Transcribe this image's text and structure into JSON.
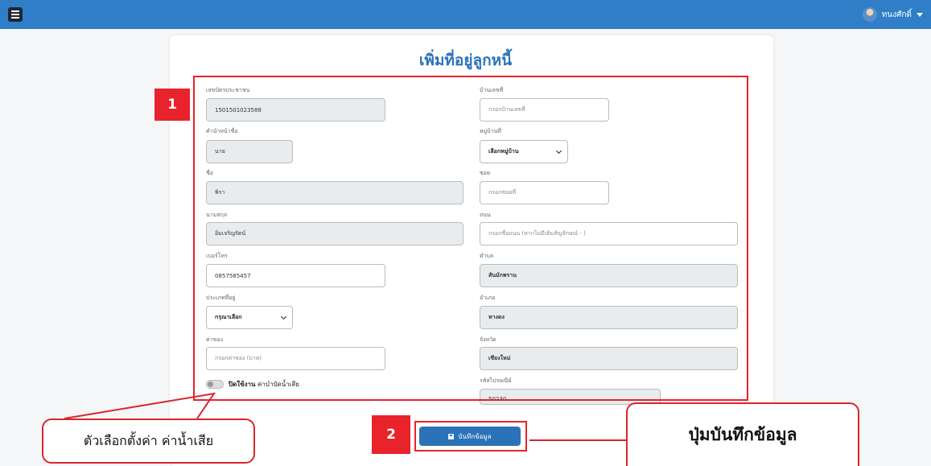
{
  "topbar": {
    "user_name": "ทนงศักดิ์"
  },
  "form": {
    "title": "เพิ่มที่อยู่ลูกหนี้",
    "left": [
      {
        "label": "เลขบัตรประชาชน",
        "value": "1501501023588"
      },
      {
        "label": "คำนำหน้าชื่อ",
        "value": "นาย"
      },
      {
        "label": "ชื่อ",
        "value": "พิรา"
      },
      {
        "label": "นามสกุล",
        "value": "อิ่มเจริญรัตน์"
      },
      {
        "label": "เบอร์โทร",
        "value": "0857585457"
      },
      {
        "label": "ประเภทที่อยู่",
        "value": "กรุณาเลือก"
      },
      {
        "label": "ค่าของ",
        "placeholder": "กรอกค่าของ (บาท)"
      }
    ],
    "right": [
      {
        "label": "บ้านเลขที่",
        "placeholder": "กรอกบ้านเลขที่"
      },
      {
        "label": "หมู่บ้านที่",
        "value": "เลือกหมู่บ้าน"
      },
      {
        "label": "ซอย",
        "placeholder": "กรอกซอยที่"
      },
      {
        "label": "ถนน",
        "placeholder": "กรอกชื่อถนน (หากไม่มีเติมสัญลักษณ์ - )"
      },
      {
        "label": "ตำบล",
        "value": "สันมักพราน"
      },
      {
        "label": "อำเภอ",
        "value": "หางดง"
      },
      {
        "label": "จังหวัด",
        "value": "เชียงใหม่"
      },
      {
        "label": "รหัสไปรษณีย์",
        "value": "50230"
      }
    ],
    "toggle": {
      "state": "ปิดใช้งาน",
      "text": "ค่าบำบัดน้ำเสีย"
    },
    "save_label": "บันทึกข้อมูล"
  },
  "annotations": {
    "badge_1": "1",
    "badge_2": "2",
    "callout_toggle": "ตัวเลือกตั้งค่า ค่าน้ำเสีย",
    "callout_save": "ปุ่มบันทึกข้อมูล"
  },
  "colors": {
    "topbar": "#2f7ec7",
    "accent": "#2a73b8",
    "annotation_red": "#e8232c"
  }
}
